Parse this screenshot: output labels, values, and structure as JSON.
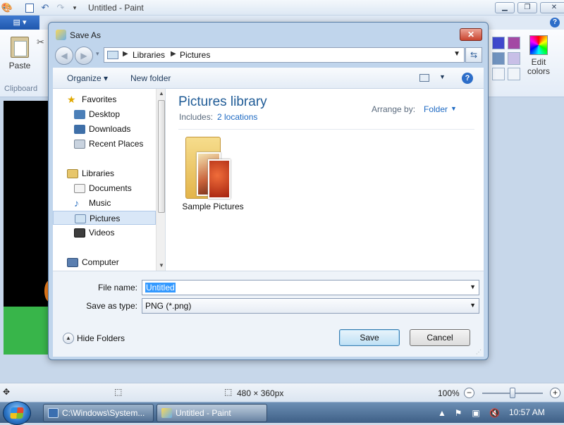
{
  "paint": {
    "title": "Untitled - Paint",
    "file_tab": "▤ ▾",
    "ribbon": {
      "paste_label": "Paste",
      "clipboard_group": "Clipboard",
      "edit_colors_label": "Edit colors"
    },
    "caption_buttons": {
      "minimize": "▁",
      "maximize": "❐",
      "close": "✕"
    },
    "help": "?",
    "statusbar": {
      "canvas_size": "480 × 360px",
      "zoom": "100%",
      "zoom_level": 0.5
    }
  },
  "dialog": {
    "title": "Save As",
    "close_glyph": "✕",
    "address": {
      "crumbs": [
        "Libraries",
        "Pictures"
      ]
    },
    "toolbar": {
      "organize": "Organize ▾",
      "new_folder": "New folder",
      "help": "?"
    },
    "nav": {
      "favorites_header": "Favorites",
      "favorites": [
        "Desktop",
        "Downloads",
        "Recent Places"
      ],
      "libraries_header": "Libraries",
      "libraries": [
        "Documents",
        "Music",
        "Pictures",
        "Videos"
      ],
      "selected": "Pictures",
      "computer": "Computer"
    },
    "content": {
      "library_title": "Pictures library",
      "includes_label": "Includes:",
      "locations_link": "2 locations",
      "arrange_label": "Arrange by:",
      "arrange_value": "Folder",
      "items": [
        {
          "name": "Sample Pictures",
          "icon": "folder-with-pictures-icon"
        }
      ]
    },
    "form": {
      "filename_label": "File name:",
      "filename_value": "Untitled",
      "type_label": "Save as type:",
      "type_value": "PNG (*.png)"
    },
    "hide_folders": "Hide Folders",
    "save_button": "Save",
    "cancel_button": "Cancel"
  },
  "taskbar": {
    "items": [
      {
        "label": "C:\\Windows\\System..."
      },
      {
        "label": "Untitled - Paint"
      }
    ],
    "clock": "10:57 AM"
  },
  "colors": {
    "accent": "#1e6ac3",
    "title_blue": "#1f5b96",
    "selection": "#3399ff"
  }
}
